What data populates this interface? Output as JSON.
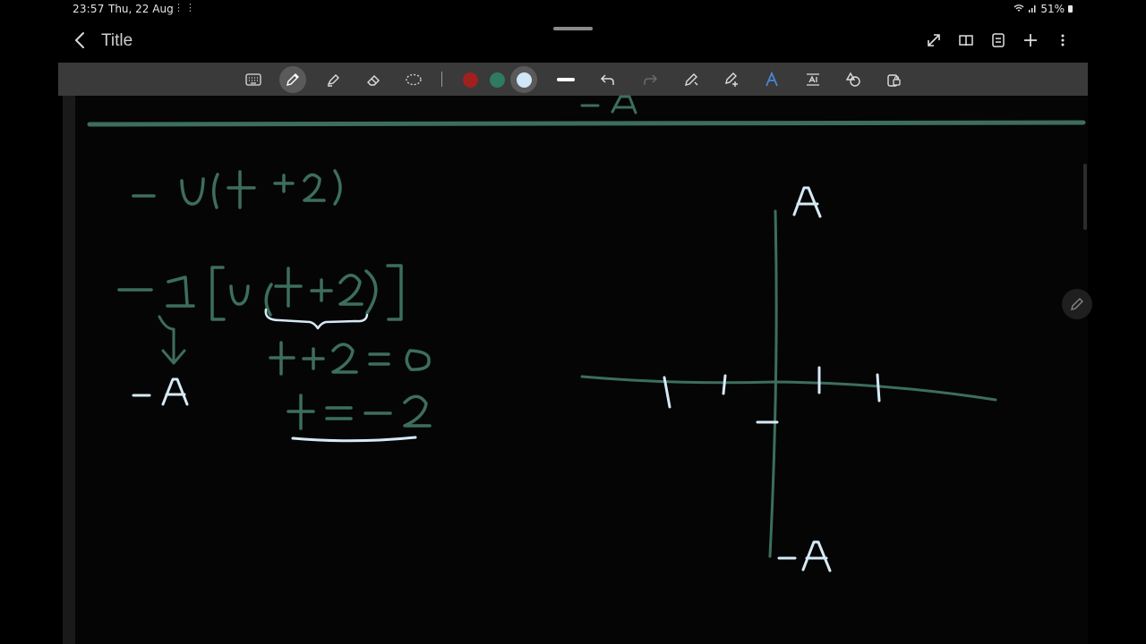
{
  "status": {
    "time": "23:57",
    "date": "Thu, 22 Aug",
    "battery": "51%"
  },
  "titlebar": {
    "title": "Title",
    "actions": [
      "expand-icon",
      "book-view-icon",
      "page-layout-icon",
      "add-icon",
      "more-icon"
    ]
  },
  "toolbar": {
    "tools": [
      "keyboard-icon",
      "pen-icon",
      "highlighter-icon",
      "eraser-icon",
      "lasso-icon"
    ],
    "active_tool": "pen-icon",
    "colors": [
      "#a1201f",
      "#2f7a63",
      "#cfe7f7"
    ],
    "selected_color": "#cfe7f7",
    "more_tools": [
      "stroke-thickness-icon",
      "undo-icon",
      "redo-icon",
      "auto-straighten-icon",
      "shape-tool-icon",
      "text-style-icon",
      "text-box-icon",
      "shapes-icon",
      "lock-icon"
    ]
  },
  "ink_colors": {
    "green": "#3d6e5d",
    "light_blue": "#d6eaf6"
  }
}
